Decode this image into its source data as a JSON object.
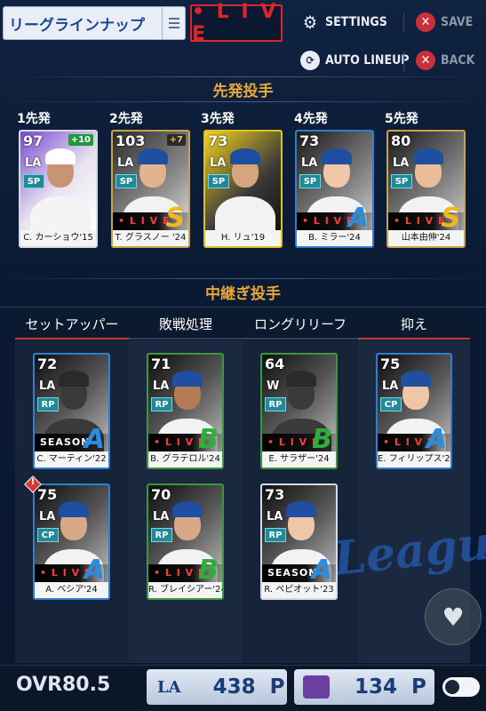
{
  "top": {
    "dropdown_label": "リーグラインナップ",
    "live_label": "• L I V E",
    "settings_label": "SETTINGS",
    "save_label": "SAVE",
    "auto_lineup_label": "AUTO LINEUP",
    "back_label": "BACK"
  },
  "starters": {
    "title": "先発投手",
    "slots": [
      {
        "slot": "1先発",
        "ovr": "97",
        "team": "LA",
        "pos": "SP",
        "plus": "+10",
        "name": "C. カーショウ'15",
        "tag": "",
        "grade": ""
      },
      {
        "slot": "2先発",
        "ovr": "103",
        "team": "LA",
        "pos": "SP",
        "plus": "+7",
        "name": "T. グラスノー '24",
        "tag": "• L I V E",
        "grade": "S"
      },
      {
        "slot": "3先発",
        "ovr": "73",
        "team": "LA",
        "pos": "SP",
        "plus": "",
        "name": "H. リュ'19",
        "tag": "",
        "grade": ""
      },
      {
        "slot": "4先発",
        "ovr": "73",
        "team": "LA",
        "pos": "SP",
        "plus": "",
        "name": "B. ミラー'24",
        "tag": "• L I V E",
        "grade": "A"
      },
      {
        "slot": "5先発",
        "ovr": "80",
        "team": "LA",
        "pos": "SP",
        "plus": "",
        "name": "山本由伸'24",
        "tag": "• L I V E",
        "grade": "S"
      }
    ]
  },
  "relievers": {
    "title": "中継ぎ投手",
    "tabs": [
      "セットアッパー",
      "敗戦処理",
      "ロングリリーフ",
      "抑え"
    ],
    "cards": [
      {
        "ovr": "72",
        "team": "LA",
        "pos": "RP",
        "name": "C. マーティン'22",
        "tag": "SEASON",
        "grade": "A"
      },
      {
        "ovr": "71",
        "team": "LA",
        "pos": "RP",
        "name": "B. グラテロル'24",
        "tag": "• L I V E",
        "grade": "B"
      },
      {
        "ovr": "64",
        "team": "W",
        "pos": "RP",
        "name": "E. サラザー'24",
        "tag": "• L I V E",
        "grade": "B"
      },
      {
        "ovr": "75",
        "team": "LA",
        "pos": "CP",
        "name": "E. フィリップス'24",
        "tag": "• L I V E",
        "grade": "A"
      },
      {
        "ovr": "75",
        "team": "LA",
        "pos": "CP",
        "name": "A. ベシア'24",
        "tag": "• L I V E",
        "grade": "A"
      },
      {
        "ovr": "70",
        "team": "LA",
        "pos": "RP",
        "name": "R. ブレイシアー'24",
        "tag": "• L I V E",
        "grade": "B"
      },
      {
        "ovr": "73",
        "team": "LA",
        "pos": "RP",
        "name": "R. ペピオット'23",
        "tag": "SEASON",
        "grade": "A"
      }
    ]
  },
  "watermark": "League",
  "bottom": {
    "ovr_label": "OVR",
    "ovr_value": "80.5",
    "team_points": "438",
    "points_unit": "P",
    "league_points": "134"
  },
  "colors": {
    "live_red": "#e0242c",
    "header_gold": "#e8a73a",
    "grade_gold": "#f0b81c",
    "grade_blue": "#2b8de0",
    "grade_green": "#2fae3a",
    "points_blue": "#1a3d78"
  }
}
